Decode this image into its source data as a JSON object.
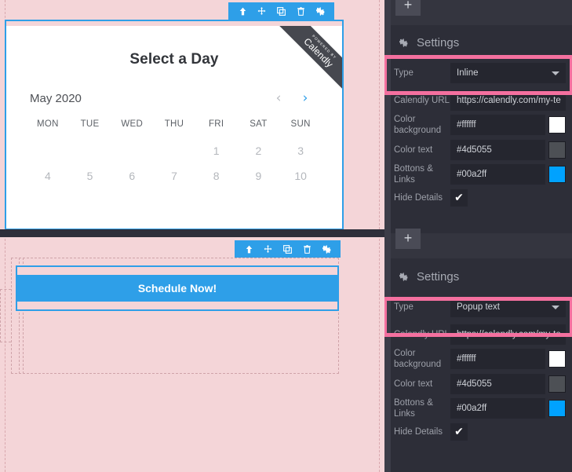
{
  "canvas": {
    "background_color": "#f4d5d8",
    "widget_toolbar": {
      "buttons": [
        {
          "name": "move-up-icon",
          "label": "Move up"
        },
        {
          "name": "drag-move-icon",
          "label": "Move"
        },
        {
          "name": "duplicate-icon",
          "label": "Duplicate"
        },
        {
          "name": "trash-icon",
          "label": "Delete"
        },
        {
          "name": "gear-icon",
          "label": "Settings"
        }
      ],
      "accent_color": "#2e9fe8"
    },
    "calendar_widget": {
      "title": "Select a Day",
      "badge_powered": "POWERED BY",
      "badge_brand": "Calendly",
      "month": "May 2020",
      "prev_arrow": "‹",
      "next_arrow": "›",
      "prev_enabled": false,
      "next_enabled": true,
      "weekdays": [
        "MON",
        "TUE",
        "WED",
        "THU",
        "FRI",
        "SAT",
        "SUN"
      ],
      "weeks": [
        [
          "",
          "",
          "",
          "",
          "1",
          "2",
          "3"
        ],
        [
          "4",
          "5",
          "6",
          "7",
          "8",
          "9",
          "10"
        ]
      ]
    },
    "button_widget": {
      "label": "Schedule Now!"
    }
  },
  "panel": {
    "add_button_label": "+",
    "sections": [
      {
        "heading": "Settings",
        "gear_icon": "gear-icon",
        "type_label": "Type",
        "type_value": "Inline",
        "url_label": "Calendly URL",
        "url_value": "https://calendly.com/my-te",
        "color_bg_label": "Color background",
        "color_bg_value": "#ffffff",
        "color_bg_swatch": "#ffffff",
        "color_text_label": "Color text",
        "color_text_value": "#4d5055",
        "color_text_swatch": "#4d5055",
        "buttons_links_label": "Bottons & Links",
        "buttons_links_value": "#00a2ff",
        "buttons_links_swatch": "#00a2ff",
        "hide_details_label": "Hide Details",
        "hide_details_checked": "✔"
      },
      {
        "heading": "Settings",
        "gear_icon": "gear-icon",
        "type_label": "Type",
        "type_value": "Popup text",
        "url_label": "Calendly URL",
        "url_value": "https://calendly.com/my-te",
        "color_bg_label": "Color background",
        "color_bg_value": "#ffffff",
        "color_bg_swatch": "#ffffff",
        "color_text_label": "Color text",
        "color_text_value": "#4d5055",
        "color_text_swatch": "#4d5055",
        "buttons_links_label": "Bottons & Links",
        "buttons_links_value": "#00a2ff",
        "buttons_links_swatch": "#00a2ff",
        "hide_details_label": "Hide Details",
        "hide_details_checked": "✔"
      }
    ],
    "highlight_color": "#f4709f"
  }
}
